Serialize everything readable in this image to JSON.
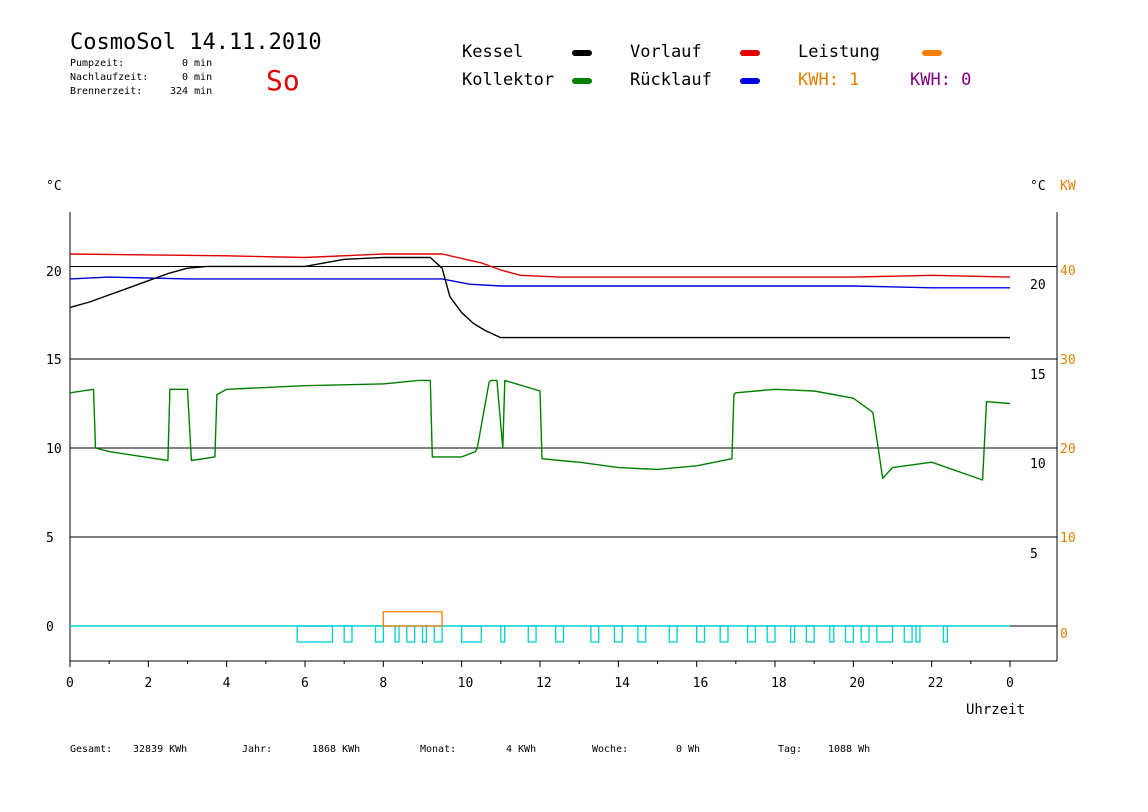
{
  "header": {
    "title": "CosmoSol 14.11.2010",
    "weekday": "So",
    "stats": [
      {
        "label": "Pumpzeit:",
        "value": "0 min"
      },
      {
        "label": "Nachlaufzeit:",
        "value": "0 min"
      },
      {
        "label": "Brennerzeit:",
        "value": "324 min"
      }
    ]
  },
  "legend": {
    "kessel": "Kessel",
    "kollektor": "Kollektor",
    "vorlauf": "Vorlauf",
    "ruecklauf": "Rücklauf",
    "leistung": "Leistung",
    "kwh1": "KWH: 1",
    "kwh2": "KWH: 0"
  },
  "footer": {
    "gesamt_label": "Gesamt:",
    "gesamt_value": "32839 KWh",
    "jahr_label": "Jahr:",
    "jahr_value": "1868 KWh",
    "monat_label": "Monat:",
    "monat_value": "4 KWh",
    "woche_label": "Woche:",
    "woche_value": "0 Wh",
    "tag_label": "Tag:",
    "tag_value": "1088 Wh"
  },
  "chart_data": {
    "type": "line",
    "xlabel": "Uhrzeit",
    "x_ticks": [
      "0",
      "2",
      "4",
      "6",
      "8",
      "10",
      "12",
      "14",
      "16",
      "18",
      "20",
      "22",
      "0"
    ],
    "x_range": [
      0,
      24
    ],
    "y_left": {
      "unit": "°C",
      "ticks": [
        "0",
        "5",
        "10",
        "15",
        "20"
      ],
      "range": [
        0,
        22.5
      ]
    },
    "y_right_inner": {
      "unit": "°C",
      "ticks": [
        "5",
        "10",
        "15",
        "20"
      ],
      "values": [
        5,
        10,
        15,
        19.5
      ]
    },
    "y_right_kw": {
      "unit": "KW",
      "ticks": [
        "0",
        "10",
        "20",
        "30",
        "40"
      ],
      "range": [
        0,
        45
      ]
    },
    "colors": {
      "kessel": "#000000",
      "kollektor": "#008000",
      "vorlauf": "#e00000",
      "ruecklauf": "#0000e0",
      "leistung": "#ff8000",
      "pump": "#00d0d0",
      "kwh2": "#800080",
      "grid": "#000000"
    },
    "series": [
      {
        "key": "vorlauf",
        "x": [
          0,
          4,
          6,
          8,
          9.5,
          10.5,
          11,
          11.5,
          12.5,
          14,
          16,
          18,
          20,
          22,
          24
        ],
        "y": [
          20.9,
          20.8,
          20.7,
          20.9,
          20.9,
          20.4,
          20.0,
          19.7,
          19.6,
          19.6,
          19.6,
          19.6,
          19.6,
          19.7,
          19.6
        ]
      },
      {
        "key": "ruecklauf",
        "x": [
          0,
          1,
          3,
          6,
          9.5,
          10.2,
          11,
          12,
          16,
          18,
          20,
          22,
          24
        ],
        "y": [
          19.5,
          19.6,
          19.5,
          19.5,
          19.5,
          19.2,
          19.1,
          19.1,
          19.1,
          19.1,
          19.1,
          19.0,
          19.0
        ]
      },
      {
        "key": "kessel",
        "x": [
          0,
          0.5,
          1,
          1.5,
          2,
          2.5,
          3,
          3.5,
          6,
          7,
          8,
          9.2,
          9.5,
          9.7,
          10,
          10.3,
          10.6,
          10.8,
          11,
          12,
          24
        ],
        "y": [
          17.9,
          18.2,
          18.6,
          19.0,
          19.4,
          19.8,
          20.1,
          20.2,
          20.2,
          20.6,
          20.7,
          20.7,
          20.1,
          18.5,
          17.6,
          17.0,
          16.6,
          16.4,
          16.2,
          16.2,
          16.2
        ]
      },
      {
        "key": "kollektor",
        "x": [
          0,
          0.6,
          0.65,
          1,
          2.5,
          2.55,
          3,
          3.1,
          3.7,
          3.75,
          4,
          6,
          8,
          8.9,
          9.2,
          9.25,
          10,
          10.35,
          10.4,
          10.7,
          10.75,
          10.9,
          11.05,
          11.1,
          12,
          12.05,
          12.5,
          13,
          14,
          15,
          16,
          16.9,
          16.95,
          17,
          18,
          19,
          20,
          20.5,
          20.75,
          21,
          22,
          23.3,
          23.4,
          24
        ],
        "y": [
          13.1,
          13.3,
          10.0,
          9.8,
          9.3,
          13.3,
          13.3,
          9.3,
          9.5,
          13.0,
          13.3,
          13.5,
          13.6,
          13.8,
          13.8,
          9.5,
          9.5,
          9.8,
          10.0,
          13.7,
          13.8,
          13.8,
          10.0,
          13.8,
          13.2,
          9.4,
          9.3,
          9.2,
          8.9,
          8.8,
          9.0,
          9.4,
          13.0,
          13.1,
          13.3,
          13.2,
          12.8,
          12.0,
          8.3,
          8.9,
          9.2,
          8.2,
          12.6,
          12.5
        ]
      }
    ],
    "leistung_x": [
      8,
      9.5
    ],
    "leistung_kw": 1.6,
    "pump_blocks": [
      [
        5.8,
        6.7
      ],
      [
        7.0,
        7.2
      ],
      [
        7.8,
        8.0
      ],
      [
        8.3,
        8.4
      ],
      [
        8.6,
        8.8
      ],
      [
        9.0,
        9.1
      ],
      [
        9.3,
        9.5
      ],
      [
        10.0,
        10.5
      ],
      [
        11.0,
        11.1
      ],
      [
        11.7,
        11.9
      ],
      [
        12.4,
        12.6
      ],
      [
        13.3,
        13.5
      ],
      [
        13.9,
        14.1
      ],
      [
        14.5,
        14.7
      ],
      [
        15.3,
        15.5
      ],
      [
        16.0,
        16.2
      ],
      [
        16.6,
        16.8
      ],
      [
        17.3,
        17.5
      ],
      [
        17.8,
        18.0
      ],
      [
        18.4,
        18.5
      ],
      [
        18.8,
        19.0
      ],
      [
        19.4,
        19.5
      ],
      [
        19.8,
        20.0
      ],
      [
        20.2,
        20.4
      ],
      [
        20.6,
        21.0
      ],
      [
        21.3,
        21.5
      ],
      [
        21.6,
        21.7
      ],
      [
        22.3,
        22.4
      ]
    ],
    "grid": true
  }
}
